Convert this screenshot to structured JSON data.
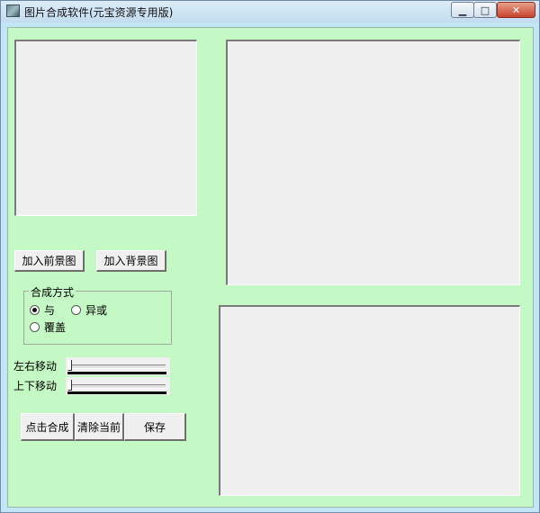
{
  "window": {
    "title": "图片合成软件(元宝资源专用版)",
    "minimize_glyph": "▁",
    "maximize_glyph": "□",
    "close_glyph": "✕"
  },
  "buttons": {
    "add_foreground": "加入前景图",
    "add_background": "加入背景图",
    "compose": "点击合成",
    "clear_current": "清除当前",
    "save": "保存"
  },
  "compose_mode": {
    "legend": "合成方式",
    "options": [
      {
        "label": "与",
        "checked": true
      },
      {
        "label": "异或",
        "checked": false
      },
      {
        "label": "覆盖",
        "checked": false
      }
    ]
  },
  "sliders": {
    "horizontal_label": "左右移动",
    "vertical_label": "上下移动",
    "horizontal_value": 0,
    "vertical_value": 0
  },
  "colors": {
    "client_background": "#c4f8c4",
    "panel_background": "#f0f0f0",
    "close_button": "#c8432e"
  },
  "icons": [
    "app-icon",
    "minimize-icon",
    "maximize-icon",
    "close-icon"
  ]
}
